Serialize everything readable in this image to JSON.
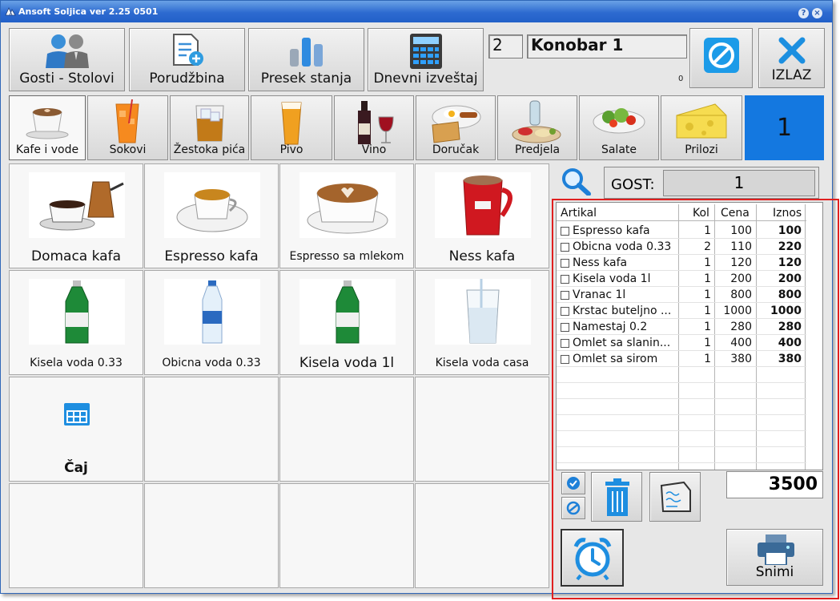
{
  "window": {
    "title": "Ansoft Soljica ver 2.25 0501",
    "help_label": "?",
    "close_label": "×"
  },
  "toolbar": {
    "guests_tables_label": "Gosti - Stolovi",
    "order_label": "Porudžbina",
    "stock_cut_label": "Presek stanja",
    "daily_report_label": "Dnevni izveštaj",
    "exit_label": "IZLAZ"
  },
  "waiter": {
    "id": "2",
    "name": "Konobar 1",
    "counter": "0"
  },
  "table_number": "1",
  "categories": [
    {
      "label": "Kafe i vode",
      "selected": true
    },
    {
      "label": "Sokovi"
    },
    {
      "label": "Žestoka pića"
    },
    {
      "label": "Pivo"
    },
    {
      "label": "Vino"
    },
    {
      "label": "Doručak"
    },
    {
      "label": "Predjela"
    },
    {
      "label": "Salate"
    },
    {
      "label": "Prilozi"
    }
  ],
  "products": [
    {
      "label": "Domaca kafa"
    },
    {
      "label": "Espresso kafa"
    },
    {
      "label": "Espresso sa mlekom"
    },
    {
      "label": "Ness kafa"
    },
    {
      "label": "Kisela voda 0.33"
    },
    {
      "label": "Obicna voda 0.33"
    },
    {
      "label": "Kisela voda 1l"
    },
    {
      "label": "Kisela voda casa"
    },
    {
      "label": "Čaj"
    }
  ],
  "guest": {
    "label": "GOST:",
    "value": "1"
  },
  "order_table": {
    "headers": {
      "item": "Artikal",
      "qty": "Kol",
      "price": "Cena",
      "amount": "Iznos"
    },
    "rows": [
      {
        "item": "Espresso kafa",
        "qty": "1",
        "price": "100",
        "amount": "100"
      },
      {
        "item": "Obicna voda 0.33",
        "qty": "2",
        "price": "110",
        "amount": "220"
      },
      {
        "item": "Ness kafa",
        "qty": "1",
        "price": "120",
        "amount": "120"
      },
      {
        "item": "Kisela voda 1l",
        "qty": "1",
        "price": "200",
        "amount": "200"
      },
      {
        "item": "Vranac 1l",
        "qty": "1",
        "price": "800",
        "amount": "800"
      },
      {
        "item": "Krstac buteljno ...",
        "qty": "1",
        "price": "1000",
        "amount": "1000"
      },
      {
        "item": "Namestaj 0.2",
        "qty": "1",
        "price": "280",
        "amount": "280"
      },
      {
        "item": "Omlet sa slanin...",
        "qty": "1",
        "price": "400",
        "amount": "400"
      },
      {
        "item": "Omlet sa sirom",
        "qty": "1",
        "price": "380",
        "amount": "380"
      }
    ]
  },
  "total": "3500",
  "save_label": "Snimi",
  "colors": {
    "accent": "#1478e0",
    "title_bar": "#2d6ad0",
    "highlight_frame": "#e02020"
  },
  "icons": [
    "guests-icon",
    "order-icon",
    "chart-icon",
    "calculator-icon",
    "cancel-icon",
    "close-icon",
    "search-icon",
    "select-all-icon",
    "deselect-all-icon",
    "trash-icon",
    "bill-icon",
    "alarm-clock-icon",
    "printer-icon"
  ]
}
